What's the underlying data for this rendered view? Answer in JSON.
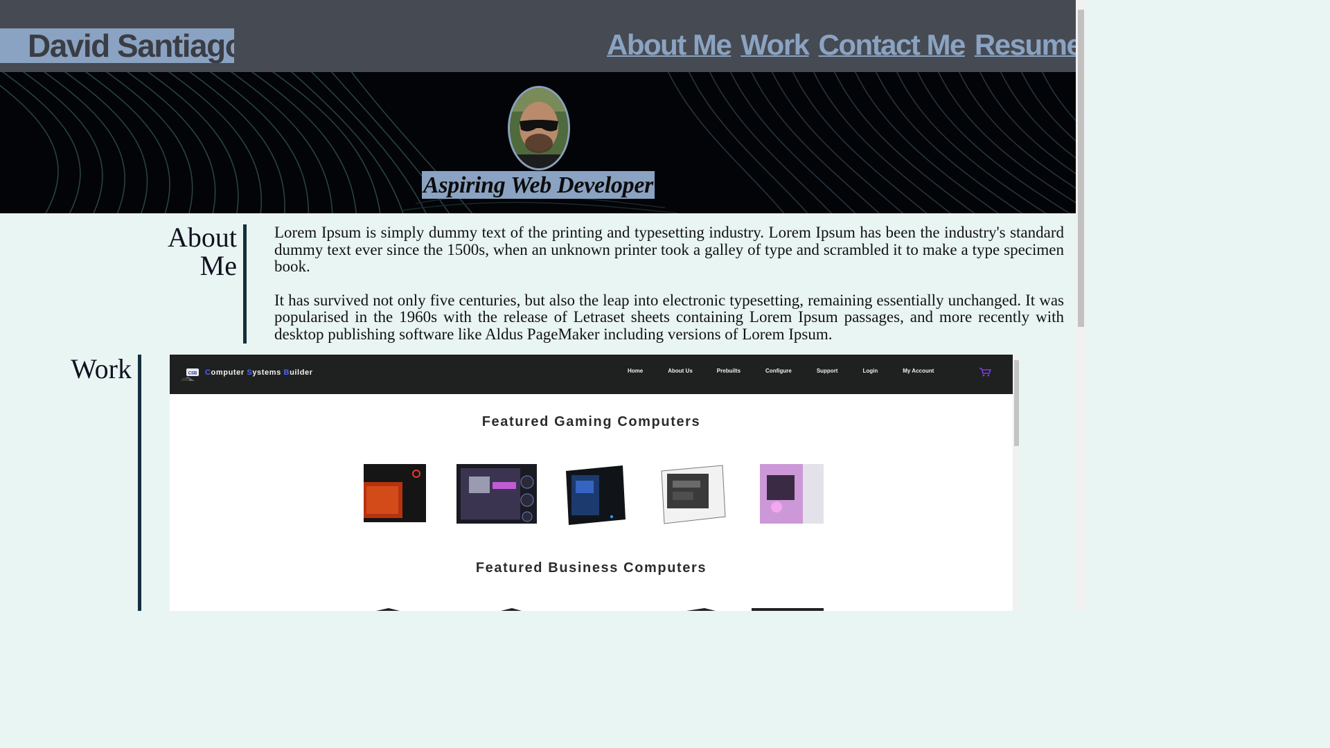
{
  "header": {
    "brand": "David Santiago",
    "nav": [
      "About Me",
      "Work",
      "Contact Me",
      "Resume"
    ]
  },
  "hero": {
    "tagline": "Aspiring Web Developer"
  },
  "about": {
    "heading_line1": "About",
    "heading_line2": "Me",
    "paragraphs": [
      "Lorem Ipsum is simply dummy text of the printing and typesetting industry. Lorem Ipsum has been the industry's standard dummy text ever since the 1500s, when an unknown printer took a galley of type and scrambled it to make a type specimen book.",
      "It has survived not only five centuries, but also the leap into electronic typesetting, remaining essentially unchanged. It was popularised in the 1960s with the release of Letraset sheets containing Lorem Ipsum passages, and more recently with desktop publishing software like Aldus PageMaker including versions of Lorem Ipsum."
    ]
  },
  "work": {
    "heading": "Work",
    "preview": {
      "brand_words": [
        {
          "first": "C",
          "rest": "omputer"
        },
        {
          "first": "S",
          "rest": "ystems"
        },
        {
          "first": "B",
          "rest": "uilder"
        }
      ],
      "logo_text": "CSB",
      "nav": [
        "Home",
        "About Us",
        "Prebuilts",
        "Configure",
        "Support",
        "Login",
        "My Account"
      ],
      "featured_gaming": "Featured Gaming Computers",
      "featured_business": "Featured Business Computers"
    }
  },
  "colors": {
    "header_bg": "#464a52",
    "accent_blue": "#8ba3c2",
    "page_bg": "#e9f5f2",
    "rule": "#15303f",
    "preview_nav_bg": "#1f2020",
    "preview_accent": "#4f64ff"
  }
}
